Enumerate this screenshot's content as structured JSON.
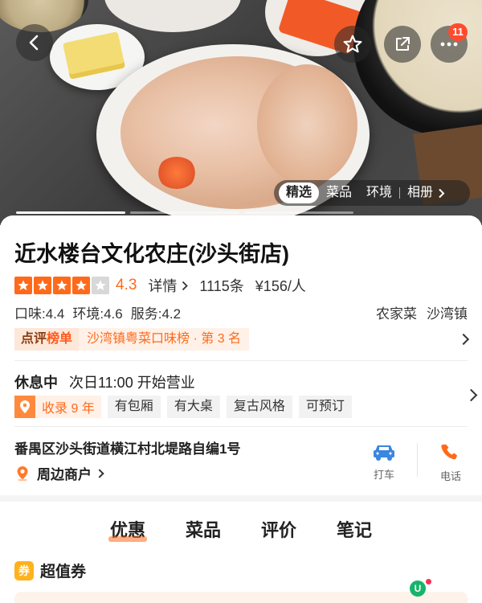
{
  "hero": {
    "notification_count": "11",
    "photo_tabs": [
      "精选",
      "菜品",
      "环境",
      "相册"
    ],
    "active_photo_tab": 0
  },
  "shop": {
    "name": "近水楼台文化农庄(沙头街店)",
    "rating": 4.3,
    "rating_text": "4.3",
    "details_label": "详情",
    "review_count": "1115条",
    "avg_price": "¥156/人",
    "taste": "口味:4.4",
    "environment": "环境:4.6",
    "service": "服务:4.2",
    "category": "农家菜",
    "area": "沙湾镇"
  },
  "ranking": {
    "label_a": "点评",
    "label_b": "榜单",
    "text": "沙湾镇粤菜口味榜 · 第 3 名"
  },
  "hours": {
    "status": "休息中",
    "next_open": "次日11:00 开始营业"
  },
  "features": {
    "collected": "收录 9 年",
    "tags": [
      "有包厢",
      "有大桌",
      "复古风格",
      "可预订"
    ]
  },
  "location": {
    "address": "番禺区沙头街道横江村北堤路自编1号",
    "nearby_label": "周边商户"
  },
  "actions": {
    "taxi_label": "打车",
    "phone_label": "电话"
  },
  "content_tabs": [
    "优惠",
    "菜品",
    "评价",
    "笔记"
  ],
  "active_content_tab": 0,
  "voucher": {
    "icon_text": "券",
    "title": "超值券"
  },
  "colors": {
    "accent": "#ff6a1a",
    "taxi_blue": "#3a86e0",
    "phone_orange": "#ff6a1a",
    "badge_red": "#ff4a2e"
  }
}
